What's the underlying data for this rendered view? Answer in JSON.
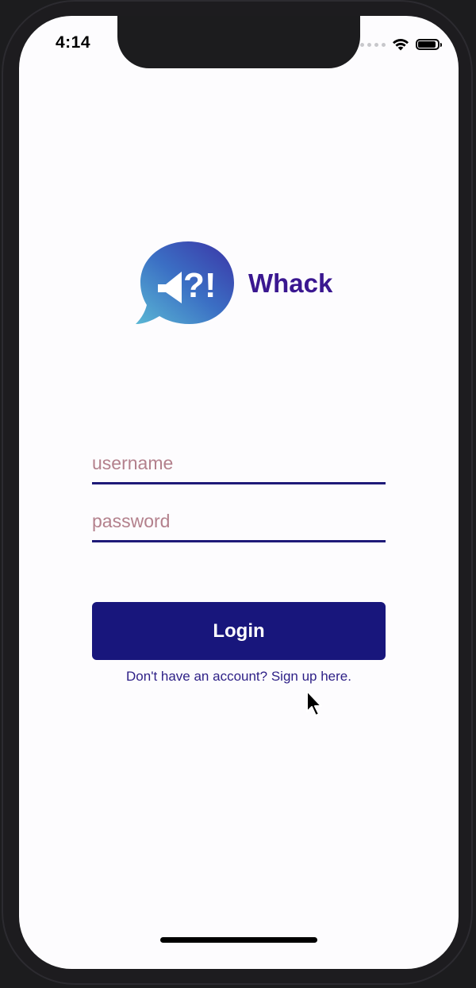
{
  "status_bar": {
    "time": "4:14",
    "wifi_icon": "wifi-icon",
    "battery_icon": "battery-icon"
  },
  "app": {
    "name": "Whack",
    "logo_icon": "megaphone-speech-bubble-icon",
    "logo_glyph": "?!",
    "brand_color": "#3a1790"
  },
  "form": {
    "username_placeholder": "username",
    "password_placeholder": "password",
    "username_value": "",
    "password_value": "",
    "login_label": "Login",
    "signup_text": "Don't have an account? Sign up here."
  },
  "colors": {
    "button": "#18167c",
    "underline": "#1f1a78",
    "placeholder": "#b3808c",
    "link": "#2d1f86"
  }
}
